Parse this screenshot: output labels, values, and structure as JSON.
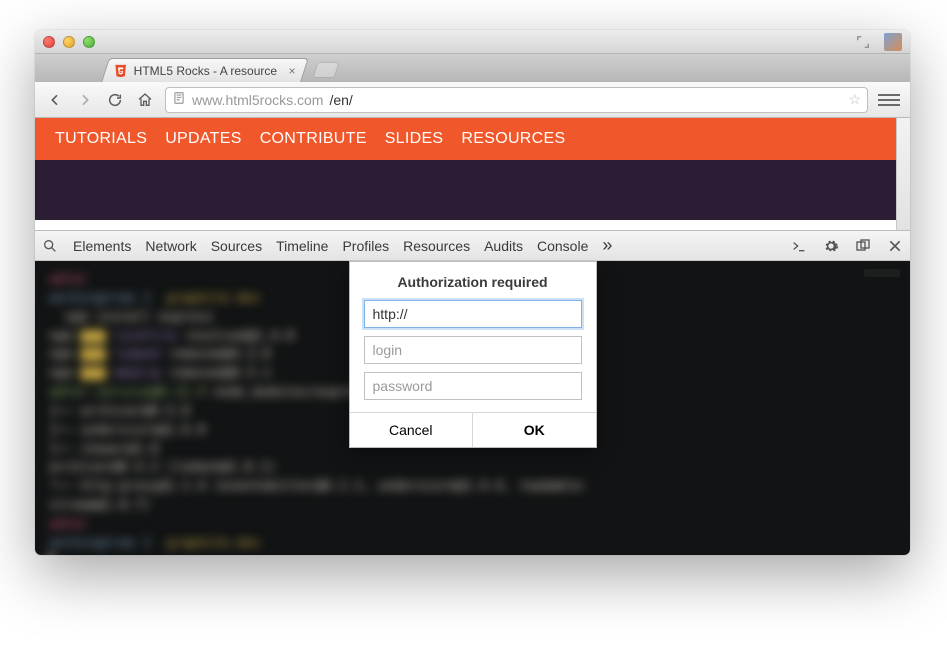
{
  "window": {
    "tab_title": "HTML5 Rocks - A resource"
  },
  "toolbar": {
    "url_display": "www.html5rocks.com",
    "url_path": "/en/"
  },
  "site_nav": {
    "items": [
      "TUTORIALS",
      "UPDATES",
      "CONTRIBUTE",
      "SLIDES",
      "RESOURCES"
    ]
  },
  "devtools": {
    "tabs": [
      "Elements",
      "Network",
      "Sources",
      "Timeline",
      "Profiles",
      "Resources",
      "Audits",
      "Console"
    ],
    "overflow": "»"
  },
  "dialog": {
    "title": "Authorization required",
    "url_value": "http://",
    "login_placeholder": "login",
    "password_placeholder": "password",
    "cancel": "Cancel",
    "ok": "OK"
  }
}
